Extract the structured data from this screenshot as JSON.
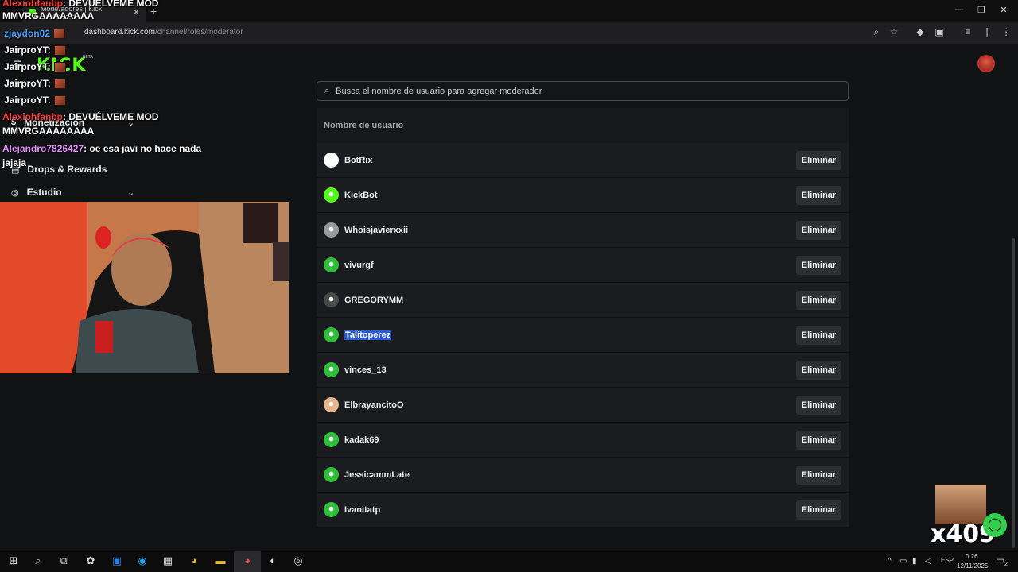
{
  "browser": {
    "tab_title": "Moderadores | Kick Dashboard",
    "url_host": "dashboard.kick.com",
    "url_path": "/channel/roles/moderator"
  },
  "sidebar": {
    "logo": "KICK",
    "beta": "BETA",
    "items": [
      {
        "label": "Monetización",
        "icon": "dollar-icon"
      },
      {
        "label": "Drops & Rewards",
        "icon": "gift-icon"
      },
      {
        "label": "Estudio",
        "icon": "camera-icon"
      }
    ]
  },
  "search": {
    "placeholder": "Busca el nombre de usuario para agregar moderador"
  },
  "table": {
    "header": "Nombre de usuario",
    "remove_label": "Eliminar",
    "rows": [
      {
        "username": "BotRix",
        "avatar_color": "#ffffff"
      },
      {
        "username": "KickBot",
        "avatar_color": "#53fc18"
      },
      {
        "username": "Whoisjavierxxii",
        "avatar_color": "#9a9a9a"
      },
      {
        "username": "vivurgf",
        "avatar_color": "#2fbf3a"
      },
      {
        "username": "GREGORYMM",
        "avatar_color": "#4a4a4a"
      },
      {
        "username": "Talitoperez",
        "avatar_color": "#2fbf3a"
      },
      {
        "username": "vinces_13",
        "avatar_color": "#2fbf3a"
      },
      {
        "username": "ElbrayancitoO",
        "avatar_color": "#e8b48a"
      },
      {
        "username": "kadak69",
        "avatar_color": "#2fbf3a"
      },
      {
        "username": "JessicammLate",
        "avatar_color": "#2fbf3a"
      },
      {
        "username": "Ivanitatp",
        "avatar_color": "#2fbf3a"
      }
    ]
  },
  "chat_overlay": [
    {
      "name": "Alexiohfanbp",
      "text": ": DEVUÉLVEME MOD"
    },
    {
      "name": "",
      "text": "MMVRGAAAAAAAA"
    },
    {
      "name": "zjaydon02",
      "text": ""
    },
    {
      "name": "JairproYT",
      "text": ":"
    },
    {
      "name": "JairproYT",
      "text": ":"
    },
    {
      "name": "JairproYT",
      "text": ":"
    },
    {
      "name": "JairproYT",
      "text": ":"
    },
    {
      "name": "Alexiohfanbp",
      "text": ": DEVUÉLVEME MOD"
    },
    {
      "name": "",
      "text": "MMVRGAAAAAAAA"
    },
    {
      "name": "Alejandro7826427",
      "text": ": oe esa javi no hace nada"
    },
    {
      "name": "",
      "text": "jajaja"
    }
  ],
  "overlay_counter": "x409",
  "taskbar": {
    "lang": "ESP",
    "time": "0:26",
    "date": "12/11/2025",
    "notif_count": "2"
  }
}
